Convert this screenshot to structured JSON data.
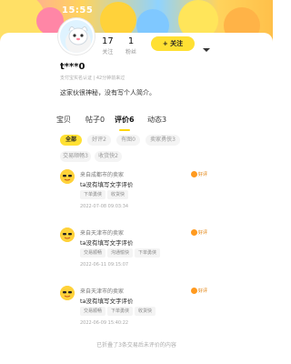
{
  "status_bar": {
    "time": "15:55"
  },
  "profile": {
    "stats": [
      {
        "value": "17",
        "label": "关注"
      },
      {
        "value": "1",
        "label": "粉丝"
      }
    ],
    "follow_label": "+ 关注",
    "nickname": "t***0",
    "subline": "支付宝实名认证 | 42分钟前来过",
    "bio": "这家伙很神秘，没有写个人简介。"
  },
  "tabs": [
    {
      "label": "宝贝"
    },
    {
      "label": "帖子0"
    },
    {
      "label": "评价6"
    },
    {
      "label": "动态3"
    }
  ],
  "filters": [
    {
      "label": "全部",
      "active": true
    },
    {
      "label": "好评2"
    },
    {
      "label": "有图0"
    },
    {
      "label": "卖家勇侠3"
    },
    {
      "label": "交易顺畅3"
    },
    {
      "label": "收货快2"
    }
  ],
  "reviews": [
    {
      "source": "来自成都市的卖家",
      "badge": "好评",
      "text": "ta没有填写文字评价",
      "tags": [
        "下单勇侠",
        "收货快"
      ],
      "time": "2022-07-08 09:03:34"
    },
    {
      "source": "来自天津市的卖家",
      "badge": "好评",
      "text": "ta没有填写文字评价",
      "tags": [
        "交易顺畅",
        "沟通愉快",
        "下单勇侠"
      ],
      "time": "2022-06-11 09:15:07"
    },
    {
      "source": "来自天津市的卖家",
      "badge": "好评",
      "text": "ta没有填写文字评价",
      "tags": [
        "交易顺畅",
        "下单勇侠",
        "收货快"
      ],
      "time": "2022-06-09 15:40:22"
    }
  ],
  "footer": "已折叠了3条交易后未评价的内容",
  "colors": {
    "accent": "#ffe033",
    "badge": "#ff9a1f"
  }
}
